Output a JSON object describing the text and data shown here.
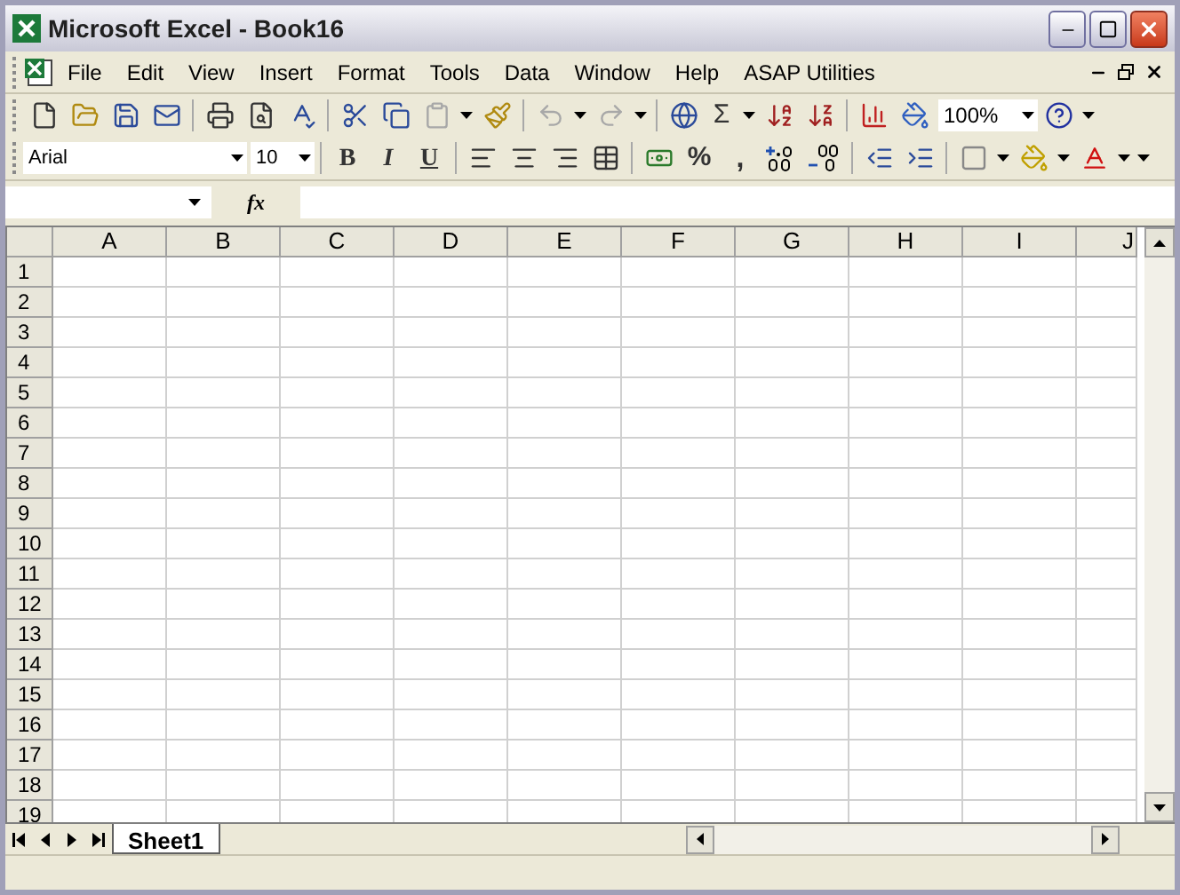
{
  "window": {
    "title": "Microsoft Excel - Book16"
  },
  "menu": [
    {
      "label": "File"
    },
    {
      "label": "Edit"
    },
    {
      "label": "View"
    },
    {
      "label": "Insert"
    },
    {
      "label": "Format"
    },
    {
      "label": "Tools"
    },
    {
      "label": "Data"
    },
    {
      "label": "Window"
    },
    {
      "label": "Help"
    },
    {
      "label": "ASAP Utilities"
    }
  ],
  "standard_toolbar": {
    "autosum": "Σ",
    "zoom": "100%"
  },
  "formatting_toolbar": {
    "font": "Arial",
    "size": "10",
    "bold": "B",
    "italic": "I",
    "underline": "U",
    "percent": "%",
    "comma": ","
  },
  "formula_bar": {
    "function_label": "fx"
  },
  "sheet": {
    "columns": [
      "A",
      "B",
      "C",
      "D",
      "E",
      "F",
      "G",
      "H",
      "I",
      "J"
    ],
    "rows": [
      "1",
      "2",
      "3",
      "4",
      "5",
      "6",
      "7",
      "8",
      "9",
      "10",
      "11",
      "12",
      "13",
      "14",
      "15",
      "16",
      "17",
      "18",
      "19"
    ]
  },
  "sheet_tabs": [
    {
      "label": "Sheet1",
      "selected": true
    }
  ]
}
